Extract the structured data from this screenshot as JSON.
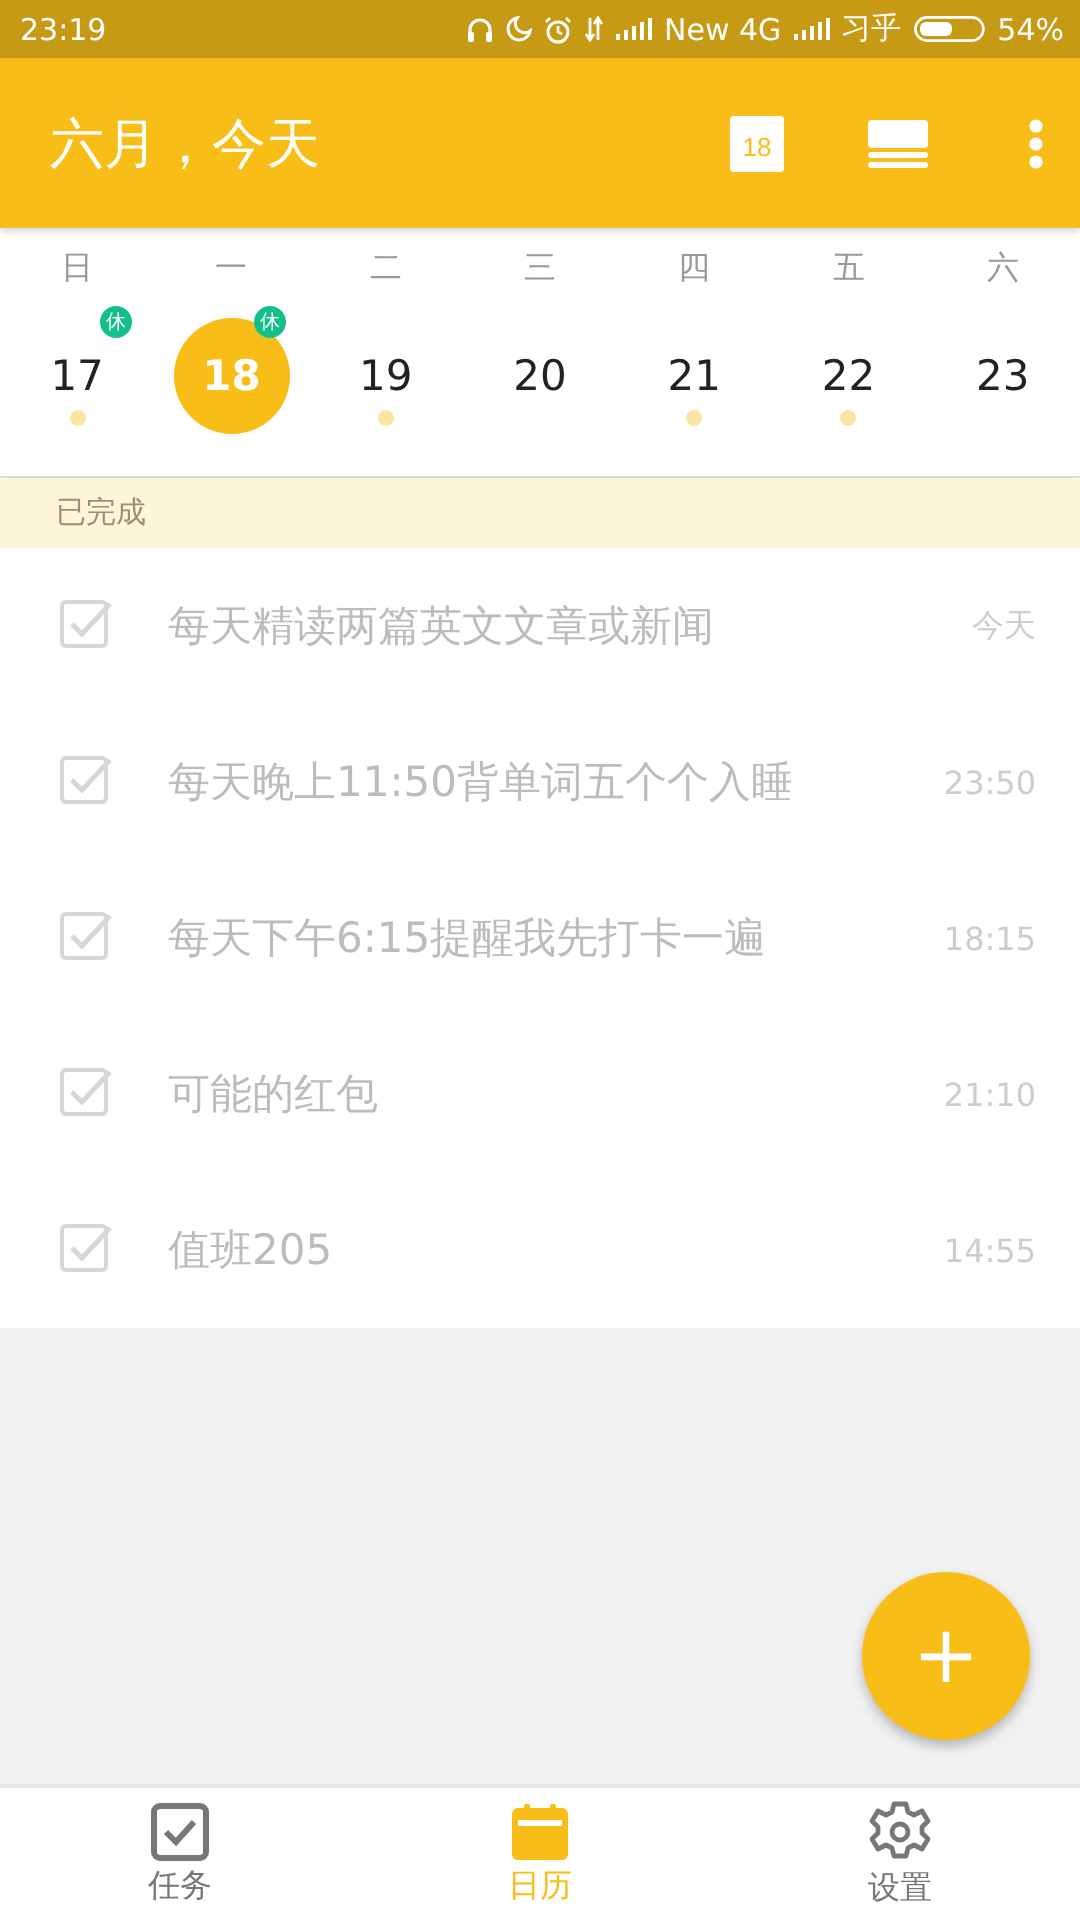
{
  "status_bar": {
    "time": "23:19",
    "network": "New 4G",
    "carrier": "习乎",
    "battery": "54%"
  },
  "header": {
    "title": "六月，今天",
    "calendar_icon_day": "18"
  },
  "week": {
    "weekdays": [
      "日",
      "一",
      "二",
      "三",
      "四",
      "五",
      "六"
    ],
    "days": [
      {
        "date": "17",
        "selected": false,
        "badge": "休",
        "has_events": true
      },
      {
        "date": "18",
        "selected": true,
        "badge": "休"
      },
      {
        "date": "19",
        "selected": false,
        "has_events": true
      },
      {
        "date": "20",
        "selected": false,
        "has_events": false
      },
      {
        "date": "21",
        "selected": false,
        "has_events": true
      },
      {
        "date": "22",
        "selected": false,
        "has_events": true
      },
      {
        "date": "23",
        "selected": false,
        "has_events": false
      }
    ]
  },
  "section": {
    "title": "已完成"
  },
  "tasks": [
    {
      "title": "每天精读两篇英文文章或新闻",
      "time": "今天",
      "checked": true
    },
    {
      "title": "每天晚上11:50背单词五个个入睡",
      "time": "23:50",
      "checked": true
    },
    {
      "title": "每天下午6:15提醒我先打卡一遍",
      "time": "18:15",
      "checked": true
    },
    {
      "title": "可能的红包",
      "time": "21:10",
      "checked": true
    },
    {
      "title": "值班205",
      "time": "14:55",
      "checked": true
    }
  ],
  "fab": {
    "label": "+"
  },
  "bottom_nav": [
    {
      "label": "任务",
      "kind": "tasks",
      "selected": false
    },
    {
      "label": "日历",
      "kind": "calendar",
      "selected": true
    },
    {
      "label": "设置",
      "kind": "settings",
      "selected": false
    }
  ]
}
